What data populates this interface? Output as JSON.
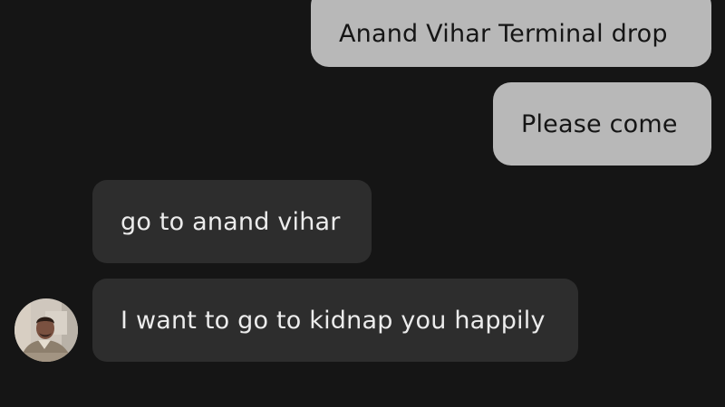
{
  "messages": [
    {
      "direction": "outgoing",
      "text": "Anand Vihar Terminal drop"
    },
    {
      "direction": "outgoing",
      "text": "Please come"
    },
    {
      "direction": "incoming",
      "text": "go to anand vihar"
    },
    {
      "direction": "incoming",
      "text": "I want to go to kidnap you happily"
    }
  ],
  "colors": {
    "background": "#151515",
    "outgoing_bubble": "#b8b8b8",
    "outgoing_text": "#151515",
    "incoming_bubble": "#2d2d2d",
    "incoming_text": "#ececec"
  },
  "avatar": {
    "icon": "driver-avatar-photo"
  }
}
